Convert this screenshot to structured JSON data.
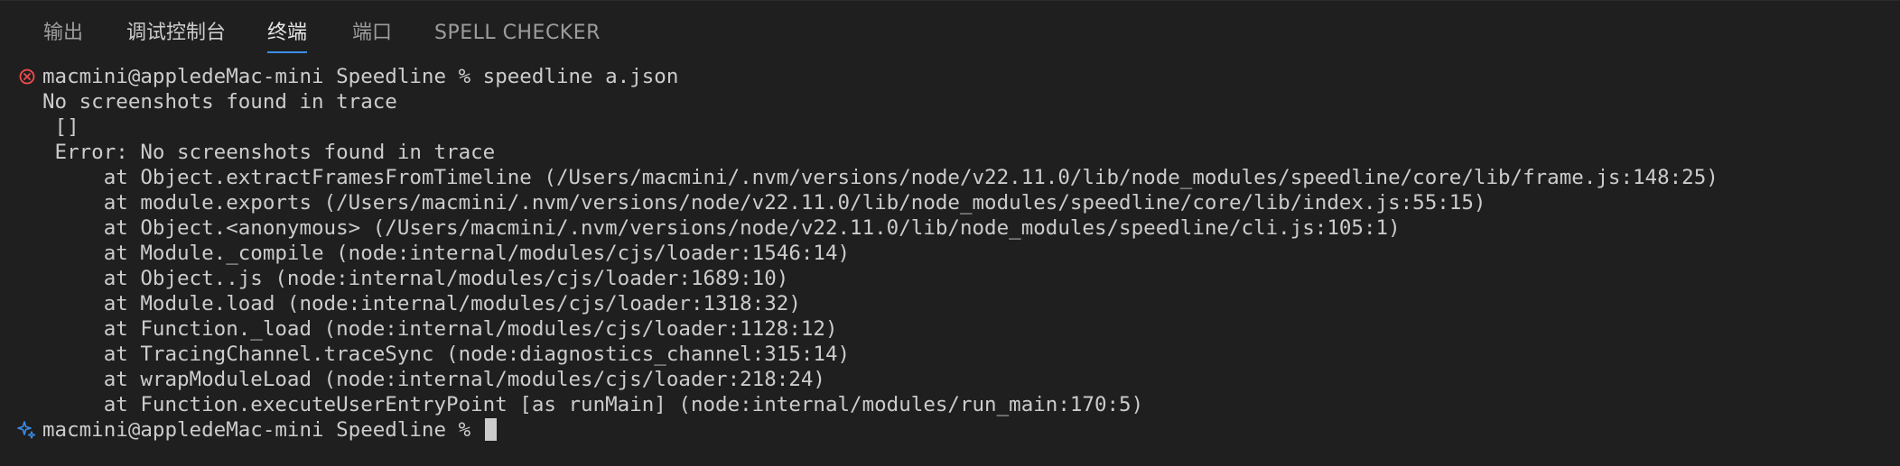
{
  "tabs": [
    {
      "label": "输出"
    },
    {
      "label": "调试控制台"
    },
    {
      "label": "终端"
    },
    {
      "label": "端口"
    },
    {
      "label": "SPELL CHECKER"
    }
  ],
  "terminal": {
    "prompt1": "macmini@appledeMac-mini Speedline % speedline a.json",
    "lines": [
      "No screenshots found in trace",
      " []",
      " Error: No screenshots found in trace",
      "     at Object.extractFramesFromTimeline (/Users/macmini/.nvm/versions/node/v22.11.0/lib/node_modules/speedline/core/lib/frame.js:148:25)",
      "     at module.exports (/Users/macmini/.nvm/versions/node/v22.11.0/lib/node_modules/speedline/core/lib/index.js:55:15)",
      "     at Object.<anonymous> (/Users/macmini/.nvm/versions/node/v22.11.0/lib/node_modules/speedline/cli.js:105:1)",
      "     at Module._compile (node:internal/modules/cjs/loader:1546:14)",
      "     at Object..js (node:internal/modules/cjs/loader:1689:10)",
      "     at Module.load (node:internal/modules/cjs/loader:1318:32)",
      "     at Function._load (node:internal/modules/cjs/loader:1128:12)",
      "     at TracingChannel.traceSync (node:diagnostics_channel:315:14)",
      "     at wrapModuleLoad (node:internal/modules/cjs/loader:218:24)",
      "     at Function.executeUserEntryPoint [as runMain] (node:internal/modules/run_main:170:5)"
    ],
    "prompt2": "macmini@appledeMac-mini Speedline % "
  },
  "colors": {
    "background": "#1f1f1f",
    "text": "#cccccc",
    "active_tab_underline": "#3b8eea",
    "error_icon": "#f14c4c",
    "sparkle_icon": "#3b8eea"
  },
  "icons": {
    "error": "error-circle-icon",
    "prompt": "sparkle-icon"
  }
}
